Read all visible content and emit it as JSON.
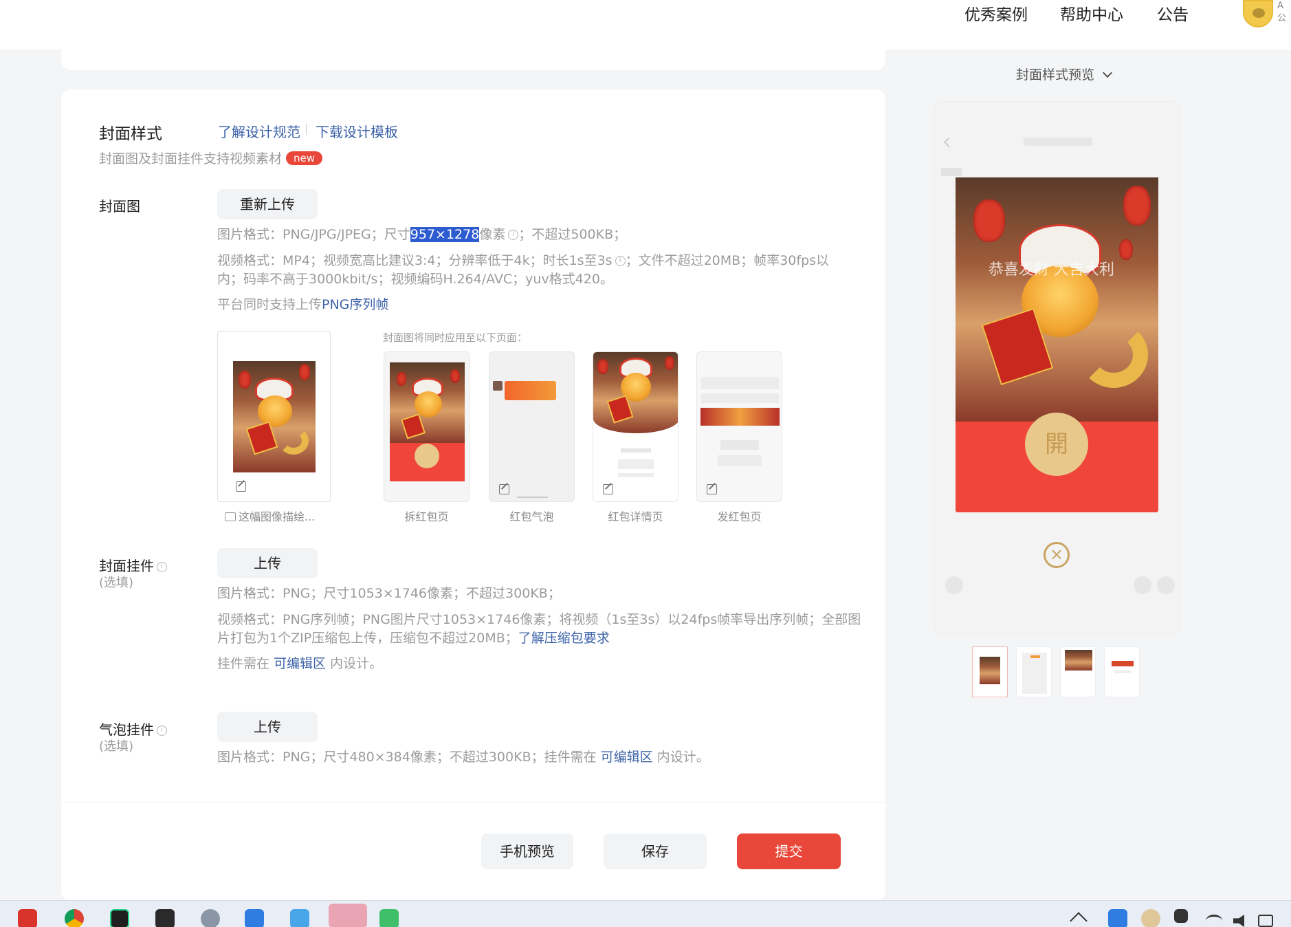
{
  "nav": {
    "items": [
      "优秀案例",
      "帮助中心",
      "公告"
    ],
    "avatar_cut": "A\n公"
  },
  "cover_style": {
    "title": "封面样式",
    "link_spec": "了解设计规范",
    "link_template": "下载设计模板",
    "subtitle": "封面图及封面挂件支持视频素材",
    "badge_new": "new"
  },
  "cover_image": {
    "label": "封面图",
    "reupload_button": "重新上传",
    "img_format_prefix": "图片格式：PNG/JPG/JPEG；尺寸",
    "img_size_selected": "957×1278",
    "img_format_suffix": "像素",
    "img_format_tail": "；不超过500KB；",
    "video_format_a": "视频格式：MP4；视频宽高比建议3:4；分辨率低于4k；时长1s至3s",
    "video_format_b": "；文件不超过20MB；帧率30fps以",
    "video_format_c": "内；码率不高于3000kbit/s；视频编码H.264/AVC；yuv格式420。",
    "png_seq_prefix": "平台同时支持上传",
    "png_seq_link": "PNG序列帧",
    "apply_note": "封面图将同时应用至以下页面：",
    "describe_label": "这幅图像描绘...",
    "pages": [
      "拆红包页",
      "红包气泡",
      "红包详情页",
      "发红包页"
    ]
  },
  "cover_widget": {
    "label": "封面挂件",
    "optional": "(选填)",
    "upload_button": "上传",
    "img_format": "图片格式：PNG；尺寸1053×1746像素；不超过300KB；",
    "video_format_a": "视频格式：PNG序列帧；PNG图片尺寸1053×1746像素；将视频（1s至3s）以24fps帧率导出序列帧；全部图",
    "video_format_b": "片打包为1个ZIP压缩包上传，压缩包不超过20MB；",
    "zip_link": "了解压缩包要求",
    "editable_prefix": "挂件需在 ",
    "editable_link": "可编辑区",
    "editable_suffix": " 内设计。"
  },
  "bubble_widget": {
    "label": "气泡挂件",
    "optional": "(选填)",
    "upload_button": "上传",
    "format_prefix": "图片格式：PNG；尺寸480×384像素；不超过300KB；挂件需在 ",
    "editable_link": "可编辑区",
    "format_suffix": " 内设计。"
  },
  "actions": {
    "phone_preview": "手机预览",
    "save": "保存",
    "submit": "提交"
  },
  "preview": {
    "selector": "封面样式预览",
    "blurred_title": "恭喜发财 大吉大利",
    "open_glyph": "開",
    "close_glyph": "×"
  },
  "colors": {
    "accent_red": "#e9473a",
    "link_blue": "#3d63a8",
    "selection_blue": "#2d5bd0"
  }
}
